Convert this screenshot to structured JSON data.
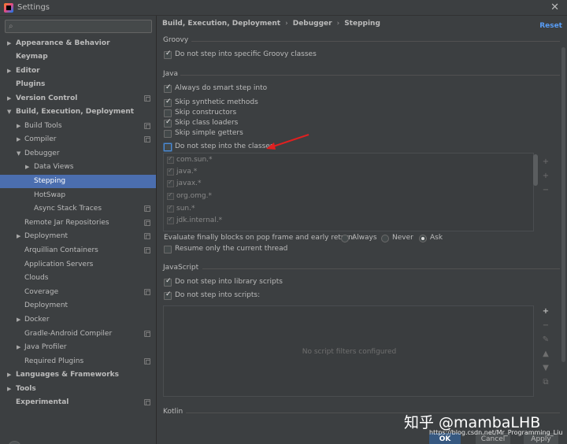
{
  "window": {
    "title": "Settings",
    "close_icon": "close-icon"
  },
  "search": {
    "placeholder": "",
    "value": ""
  },
  "sidebar": {
    "items": [
      {
        "label": "Appearance & Behavior",
        "bold": true,
        "arrow": "▶",
        "level": 0,
        "badge": false
      },
      {
        "label": "Keymap",
        "bold": true,
        "arrow": "",
        "level": 0,
        "badge": false
      },
      {
        "label": "Editor",
        "bold": true,
        "arrow": "▶",
        "level": 0,
        "badge": false
      },
      {
        "label": "Plugins",
        "bold": true,
        "arrow": "",
        "level": 0,
        "badge": false
      },
      {
        "label": "Version Control",
        "bold": true,
        "arrow": "▶",
        "level": 0,
        "badge": true
      },
      {
        "label": "Build, Execution, Deployment",
        "bold": true,
        "arrow": "▼",
        "level": 0,
        "badge": false
      },
      {
        "label": "Build Tools",
        "bold": false,
        "arrow": "▶",
        "level": 1,
        "badge": true
      },
      {
        "label": "Compiler",
        "bold": false,
        "arrow": "▶",
        "level": 1,
        "badge": true
      },
      {
        "label": "Debugger",
        "bold": false,
        "arrow": "▼",
        "level": 1,
        "badge": false
      },
      {
        "label": "Data Views",
        "bold": false,
        "arrow": "▶",
        "level": 2,
        "badge": false
      },
      {
        "label": "Stepping",
        "bold": false,
        "arrow": "",
        "level": 2,
        "badge": false,
        "selected": true
      },
      {
        "label": "HotSwap",
        "bold": false,
        "arrow": "",
        "level": 2,
        "badge": false
      },
      {
        "label": "Async Stack Traces",
        "bold": false,
        "arrow": "",
        "level": 2,
        "badge": true
      },
      {
        "label": "Remote Jar Repositories",
        "bold": false,
        "arrow": "",
        "level": 1,
        "badge": true
      },
      {
        "label": "Deployment",
        "bold": false,
        "arrow": "▶",
        "level": 1,
        "badge": true
      },
      {
        "label": "Arquillian Containers",
        "bold": false,
        "arrow": "",
        "level": 1,
        "badge": true
      },
      {
        "label": "Application Servers",
        "bold": false,
        "arrow": "",
        "level": 1,
        "badge": false
      },
      {
        "label": "Clouds",
        "bold": false,
        "arrow": "",
        "level": 1,
        "badge": false
      },
      {
        "label": "Coverage",
        "bold": false,
        "arrow": "",
        "level": 1,
        "badge": true
      },
      {
        "label": "Deployment",
        "bold": false,
        "arrow": "",
        "level": 1,
        "badge": false
      },
      {
        "label": "Docker",
        "bold": false,
        "arrow": "▶",
        "level": 1,
        "badge": false
      },
      {
        "label": "Gradle-Android Compiler",
        "bold": false,
        "arrow": "",
        "level": 1,
        "badge": true
      },
      {
        "label": "Java Profiler",
        "bold": false,
        "arrow": "▶",
        "level": 1,
        "badge": false
      },
      {
        "label": "Required Plugins",
        "bold": false,
        "arrow": "",
        "level": 1,
        "badge": true
      },
      {
        "label": "Languages & Frameworks",
        "bold": true,
        "arrow": "▶",
        "level": 0,
        "badge": false
      },
      {
        "label": "Tools",
        "bold": true,
        "arrow": "▶",
        "level": 0,
        "badge": false
      },
      {
        "label": "Experimental",
        "bold": true,
        "arrow": "",
        "level": 0,
        "badge": true
      }
    ],
    "help_label": "?"
  },
  "breadcrumb": {
    "parts": [
      "Build, Execution, Deployment",
      "Debugger",
      "Stepping"
    ],
    "separator": "›"
  },
  "reset_label": "Reset",
  "groovy": {
    "title": "Groovy",
    "options": [
      {
        "label": "Do not step into specific Groovy classes",
        "checked": true
      }
    ]
  },
  "java": {
    "title": "Java",
    "options": [
      {
        "label": "Always do smart step into",
        "checked": true
      },
      {
        "label": "Skip synthetic methods",
        "checked": true
      },
      {
        "label": "Skip constructors",
        "checked": false
      },
      {
        "label": "Skip class loaders",
        "checked": true
      },
      {
        "label": "Skip simple getters",
        "checked": false
      },
      {
        "label": "Do not step into the classes",
        "checked": false,
        "focused": true
      }
    ],
    "class_filters": [
      "com.sun.*",
      "java.*",
      "javax.*",
      "org.omg.*",
      "sun.*",
      "jdk.internal.*"
    ],
    "evaluate_label": "Evaluate finally blocks on pop frame and early return:",
    "evaluate_options": [
      {
        "label": "Always",
        "selected": false
      },
      {
        "label": "Never",
        "selected": false
      },
      {
        "label": "Ask",
        "selected": true
      }
    ],
    "resume_thread": {
      "label": "Resume only the current thread",
      "checked": false
    }
  },
  "javascript": {
    "title": "JavaScript",
    "options": [
      {
        "label": "Do not step into library scripts",
        "checked": true
      },
      {
        "label": "Do not step into scripts:",
        "checked": true
      }
    ],
    "empty_text": "No script filters configured"
  },
  "kotlin": {
    "title": "Kotlin"
  },
  "buttons": {
    "ok": "OK",
    "cancel": "Cancel",
    "apply": "Apply"
  },
  "watermark": {
    "text": "知乎 @mambaLHB",
    "url": "https://blog.csdn.net/Mr_Programming_Liu"
  },
  "colors": {
    "selection": "#4b6eaf",
    "link": "#589df6",
    "annotation_arrow": "#e02020",
    "background": "#3c3f41"
  }
}
